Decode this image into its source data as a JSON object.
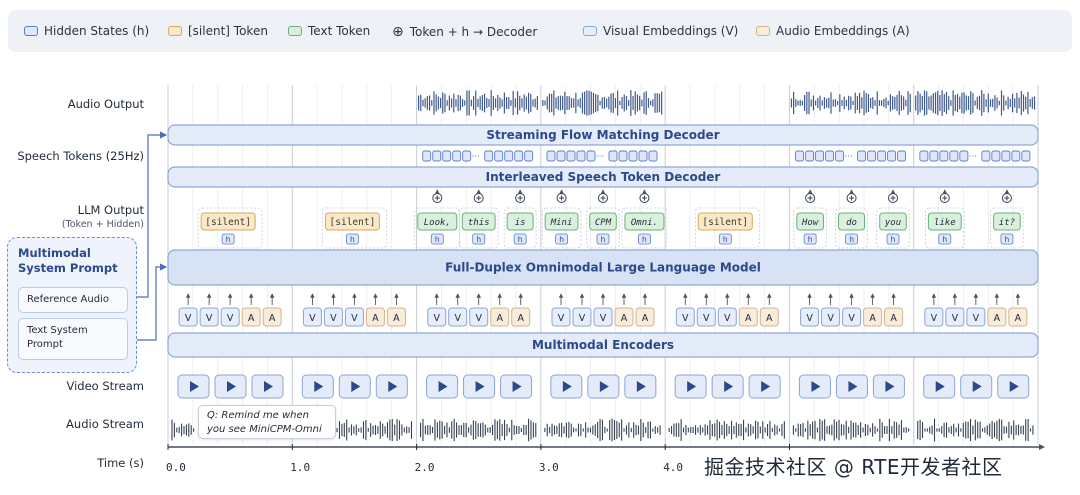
{
  "legend": [
    {
      "label": "Hidden States (h)",
      "icon": "hidden-swatch",
      "fill": "#dfe7fb",
      "stroke": "#5a7dc8"
    },
    {
      "label": "[silent] Token",
      "icon": "silent-swatch",
      "fill": "#fbe8c6",
      "stroke": "#d8a85a"
    },
    {
      "label": "Text Token",
      "icon": "text-swatch",
      "fill": "#d9f0dc",
      "stroke": "#6ab07a"
    },
    {
      "label": "Token + h → Decoder",
      "icon": "plus-circle-icon"
    },
    {
      "label": "Visual Embeddings (V)",
      "icon": "visual-swatch",
      "fill": "#e6eefb",
      "stroke": "#8aa5d8"
    },
    {
      "label": "Audio Embeddings (A)",
      "icon": "audio-swatch",
      "fill": "#f8ecdb",
      "stroke": "#d5b48a"
    }
  ],
  "rows": {
    "audio_output": "Audio Output",
    "speech_tokens": "Speech Tokens (25Hz)",
    "llm_output": "LLM Output",
    "llm_output_sub": "(Token + Hidden)",
    "video_stream": "Video Stream",
    "audio_stream": "Audio Stream",
    "time": "Time (s)"
  },
  "bars": {
    "flow": "Streaming Flow Matching Decoder",
    "interleaved": "Interleaved Speech Token Decoder",
    "llm": "Full-Duplex Omnimodal Large Language Model",
    "encoders": "Multimodal Encoders"
  },
  "prompt": {
    "title": "Multimodal System Prompt",
    "reference_audio": "Reference Audio",
    "text_prompt": "Text System Prompt"
  },
  "time_ticks": [
    "0.0",
    "1.0",
    "2.0",
    "3.0",
    "4.0"
  ],
  "query": "Q: Remind me when you see MiniCPM-Omni",
  "silent_token": "[silent]",
  "hidden_label": "h",
  "embedding_groups": [
    [
      "V",
      "V",
      "V",
      "A",
      "A"
    ],
    [
      "V",
      "V",
      "V",
      "A",
      "A"
    ],
    [
      "V",
      "V",
      "V",
      "A",
      "A"
    ],
    [
      "V",
      "V",
      "V",
      "A",
      "A"
    ],
    [
      "V",
      "V",
      "V",
      "A",
      "A"
    ],
    [
      "V",
      "V",
      "V",
      "A",
      "A"
    ],
    [
      "V",
      "V",
      "V",
      "A",
      "A"
    ]
  ],
  "chunks": [
    {
      "kind": "silent"
    },
    {
      "kind": "silent"
    },
    {
      "kind": "text",
      "tokens": [
        "Look,",
        "this",
        "is"
      ]
    },
    {
      "kind": "text",
      "tokens": [
        "Mini",
        "CPM",
        "Omni."
      ]
    },
    {
      "kind": "silent"
    },
    {
      "kind": "text",
      "tokens": [
        "How",
        "do",
        "you"
      ]
    },
    {
      "kind": "text",
      "tokens": [
        "like",
        "it?"
      ]
    }
  ],
  "speech_groups": [
    2,
    3,
    5,
    6
  ],
  "audio_output_active": [
    2,
    3,
    5,
    6
  ],
  "watermark": "掘金技术社区 @ RTE开发者社区"
}
